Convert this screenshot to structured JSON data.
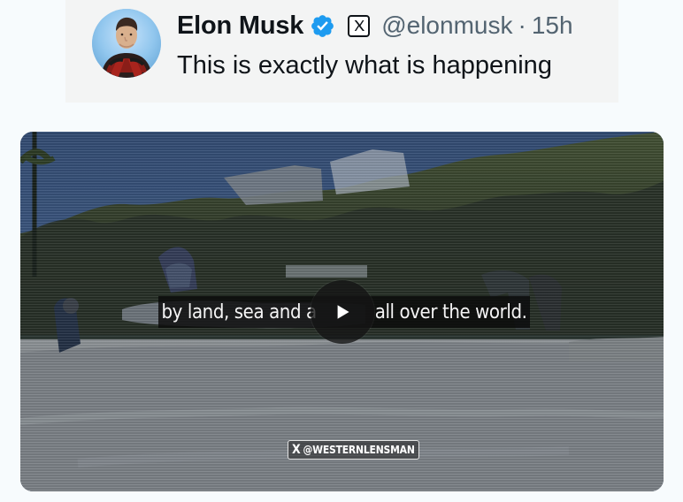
{
  "tweet": {
    "author_name": "Elon Musk",
    "handle": "@elonmusk",
    "separator": "·",
    "timestamp": "15h",
    "text": "This is exactly what is happening",
    "verified_icon": "verified-badge-icon",
    "affiliation_icon": "x-logo-icon"
  },
  "video": {
    "subtitle": "by land, sea and a",
    "subtitle_tail": "all over the world.",
    "watermark": "@WESTERNLENSMAN",
    "watermark_logo": "x-logo-icon",
    "play_icon": "play-icon"
  },
  "colors": {
    "text_primary": "#0f1419",
    "text_secondary": "#536471",
    "verified_blue": "#1d9bf0"
  }
}
